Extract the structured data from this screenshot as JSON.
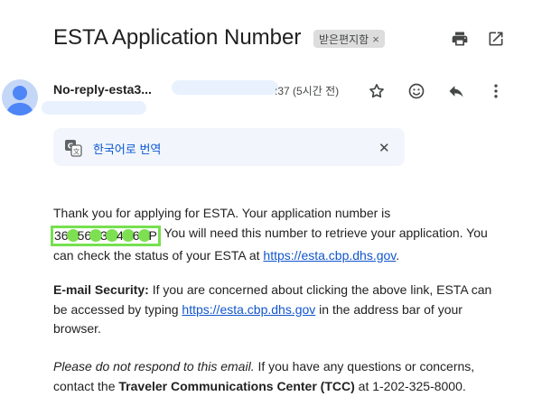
{
  "header": {
    "subject": "ESTA Application Number",
    "label": "받은편지함",
    "label_remove": "×",
    "icons": [
      "print-icon",
      "open-in-new-window-icon"
    ]
  },
  "message": {
    "sender_name": "No-reply-esta3...",
    "time": ":37 (5시간 전)",
    "icons": [
      "star-icon",
      "emoji-icon",
      "reply-icon",
      "more-vert-icon"
    ]
  },
  "translate": {
    "label": "한국어로 번역",
    "close": "✕"
  },
  "body": {
    "p1_a": "Thank you for applying for ESTA. Your application number is",
    "app_number_chars": [
      "36",
      "56",
      "3",
      "4",
      "6",
      "P"
    ],
    "p1_b": " You will need this number to retrieve your application. You can check the status of your ESTA at ",
    "link1": "https://esta.cbp.dhs.gov",
    "p1_c": ".",
    "p2_bold": "E-mail Security:",
    "p2_a": " If you are concerned about clicking the above link, ESTA can be accessed by typing ",
    "link2": "https://esta.cbp.dhs.gov",
    "p2_b": " in the address bar of your browser.",
    "p3_italic": "Please do not respond to this email.",
    "p3_a": " If you have any questions or concerns, contact the ",
    "p3_bold": "Traveler Communications Center (TCC)",
    "p3_b": " at 1-202-325-8000."
  },
  "colors": {
    "accent": "#0b57d0",
    "link": "#1155cc",
    "highlight": "#76e04f"
  }
}
